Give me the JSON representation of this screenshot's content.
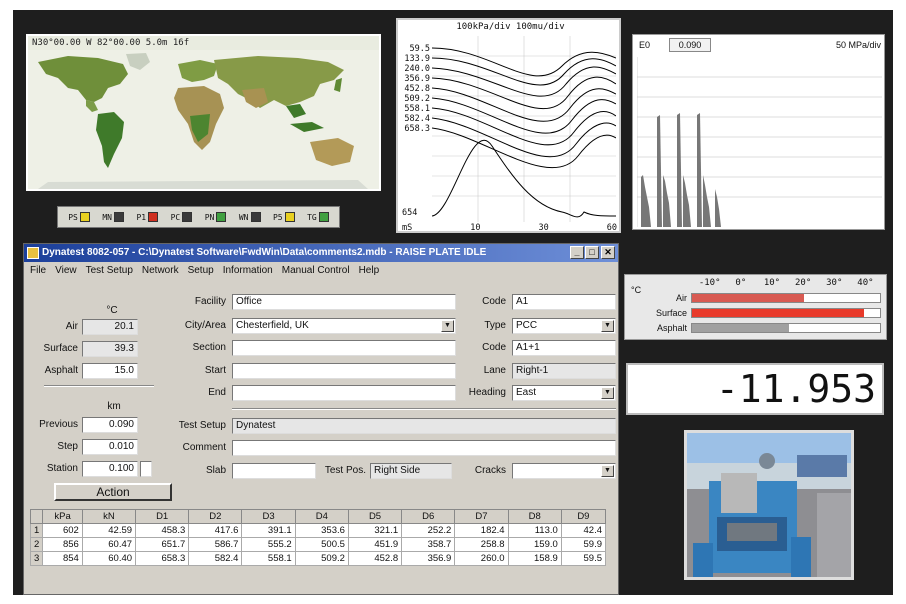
{
  "map": {
    "coords": "N30°00.00 W 82°00.00 5.0m 16f"
  },
  "legend": {
    "items": [
      {
        "label": "PS",
        "color": "#e8d020"
      },
      {
        "label": "MN",
        "color": "#3a3a3a"
      },
      {
        "label": "P1",
        "color": "#d03020"
      },
      {
        "label": "PC",
        "color": "#3a3a3a"
      },
      {
        "label": "PN",
        "color": "#40a040"
      },
      {
        "label": "WN",
        "color": "#3a3a3a"
      },
      {
        "label": "P5",
        "color": "#e8d020"
      },
      {
        "label": "TG",
        "color": "#40a040"
      }
    ]
  },
  "wave": {
    "title": "100kPa/div 100mu/div",
    "values": [
      "59.5",
      "133.9",
      "240.0",
      "356.9",
      "452.8",
      "509.2",
      "558.1",
      "582.4",
      "658.3"
    ],
    "y_bottom": "654",
    "x_unit": "mS",
    "x_ticks": [
      "10",
      "30",
      "60"
    ]
  },
  "bargraph": {
    "label": "E0",
    "value": "0.090",
    "scale": "50 MPa/div"
  },
  "temps": {
    "unit": "°C",
    "ticks": [
      "-10°",
      "0°",
      "10°",
      "20°",
      "30°",
      "40°"
    ],
    "tick_values": [
      -10,
      0,
      10,
      20,
      30,
      40
    ],
    "range": [
      -16,
      45
    ],
    "rows": [
      {
        "label": "Air",
        "value": 20.1,
        "color": "#d85a52"
      },
      {
        "label": "Surface",
        "value": 39.3,
        "color": "#e83a2a"
      },
      {
        "label": "Asphalt",
        "value": 15.0,
        "color": "#a0a0a0"
      }
    ]
  },
  "readout": "-11.953",
  "window": {
    "title": "Dynatest 8082-057 - C:\\Dynatest Software\\FwdWin\\Data\\comments2.mdb - RAISE PLATE IDLE",
    "menu": [
      "File",
      "View",
      "Test Setup",
      "Network",
      "Setup",
      "Information",
      "Manual Control",
      "Help"
    ],
    "temp_unit": "°C",
    "air_label": "Air",
    "air_value": "20.1",
    "surface_label": "Surface",
    "surface_value": "39.3",
    "asphalt_label": "Asphalt",
    "asphalt_value": "15.0",
    "dist_unit": "km",
    "previous_label": "Previous",
    "previous_value": "0.090",
    "step_label": "Step",
    "step_value": "0.010",
    "station_label": "Station",
    "station_value": "0.100",
    "action_label": "Action",
    "facility_label": "Facility",
    "facility_value": "Office",
    "city_label": "City/Area",
    "city_value": "Chesterfield, UK",
    "section_label": "Section",
    "section_value": "",
    "start_label": "Start",
    "start_value": "",
    "end_label": "End",
    "end_value": "",
    "testsetup_label": "Test Setup",
    "testsetup_value": "Dynatest",
    "comment_label": "Comment",
    "comment_value": "",
    "slab_label": "Slab",
    "slab_value": "",
    "testpos_label": "Test Pos.",
    "testpos_value": "Right Side",
    "cracks_label": "Cracks",
    "cracks_value": "",
    "code1_label": "Code",
    "code1_value": "A1",
    "type_label": "Type",
    "type_value": "PCC",
    "code2_label": "Code",
    "code2_value": "A1+1",
    "lane_label": "Lane",
    "lane_value": "Right-1",
    "heading_label": "Heading",
    "heading_value": "East"
  },
  "grid": {
    "headers": [
      "",
      "kPa",
      "kN",
      "D1",
      "D2",
      "D3",
      "D4",
      "D5",
      "D6",
      "D7",
      "D8",
      "D9"
    ],
    "rows": [
      [
        "1",
        "602",
        "42.59",
        "458.3",
        "417.6",
        "391.1",
        "353.6",
        "321.1",
        "252.2",
        "182.4",
        "113.0",
        "42.4"
      ],
      [
        "2",
        "856",
        "60.47",
        "651.7",
        "586.7",
        "555.2",
        "500.5",
        "451.9",
        "358.7",
        "258.8",
        "159.0",
        "59.9"
      ],
      [
        "3",
        "854",
        "60.40",
        "658.3",
        "582.4",
        "558.1",
        "509.2",
        "452.8",
        "356.9",
        "260.0",
        "158.9",
        "59.5"
      ]
    ]
  }
}
